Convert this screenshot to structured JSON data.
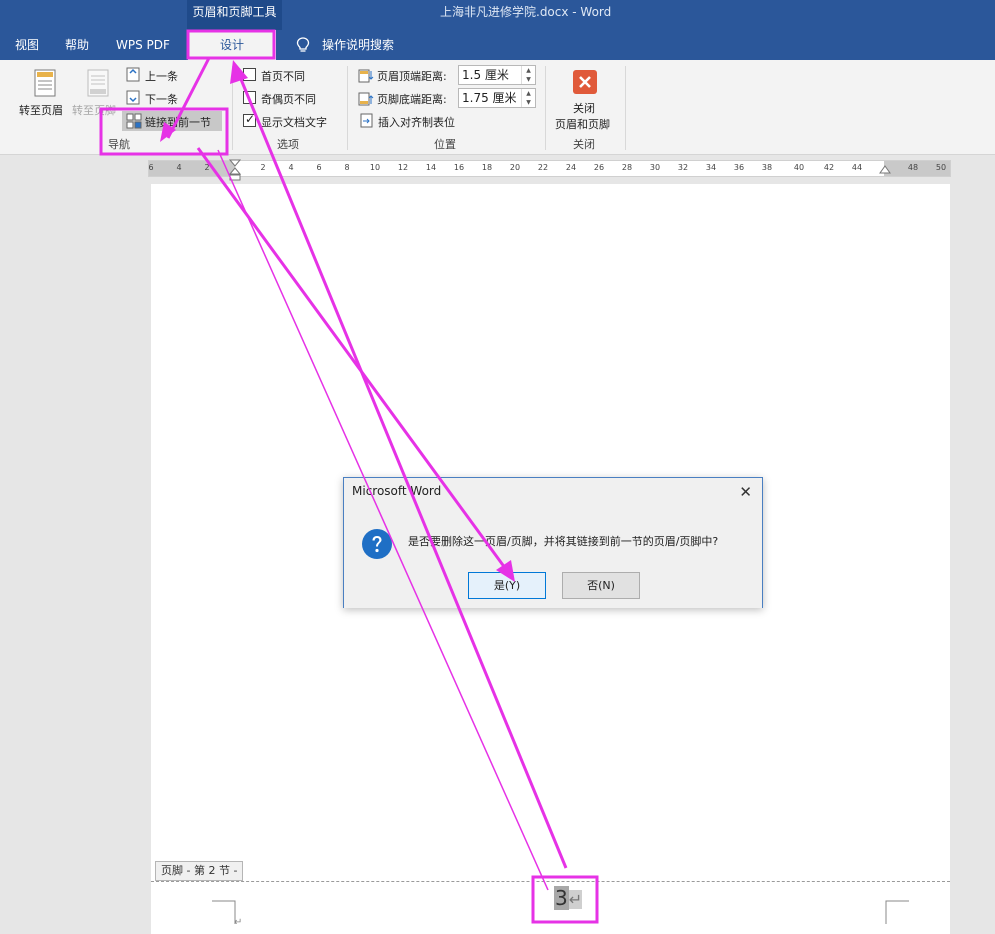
{
  "titlebar": {
    "context_tab_label": "页眉和页脚工具",
    "doc_title": "上海非凡进修学院.docx  -  Word"
  },
  "tabs": [
    {
      "label": "视图"
    },
    {
      "label": "帮助"
    },
    {
      "label": "WPS PDF"
    },
    {
      "label": "设计"
    }
  ],
  "tellme": {
    "label": "操作说明搜索",
    "icon": "lightbulb-icon"
  },
  "ribbon": {
    "navigation": {
      "goto_header": "转至页眉",
      "goto_footer": "转至页脚",
      "previous": "上一条",
      "next": "下一条",
      "link_to_previous": "链接到前一节",
      "group_label": "导航"
    },
    "options": {
      "different_first_page": "首页不同",
      "different_odd_even": "奇偶页不同",
      "show_document_text": "显示文档文字",
      "show_document_text_checked": true,
      "group_label": "选项"
    },
    "position": {
      "header_top_label": "页眉顶端距离:",
      "header_top_value": "1.5 厘米",
      "footer_bottom_label": "页脚底端距离:",
      "footer_bottom_value": "1.75 厘米",
      "insert_alignment_tab": "插入对齐制表位",
      "group_label": "位置"
    },
    "close": {
      "close_label_1": "关闭",
      "close_label_2": "页眉和页脚",
      "group_label": "关闭"
    }
  },
  "ruler": {
    "labels": [
      "6",
      "4",
      "2",
      "2",
      "4",
      "6",
      "8",
      "10",
      "12",
      "14",
      "16",
      "18",
      "20",
      "22",
      "24",
      "26",
      "28",
      "30",
      "32",
      "34",
      "36",
      "38",
      "40",
      "42",
      "44",
      "48",
      "50"
    ]
  },
  "document": {
    "footer_tag": "页脚 - 第 2 节 -",
    "page_number": "3",
    "return_mark": "↵"
  },
  "dialog": {
    "title": "Microsoft Word",
    "message": "是否要删除这一页眉/页脚，并将其链接到前一节的页眉/页脚中?",
    "yes_label": "是(Y)",
    "no_label": "否(N)",
    "icon": "question-icon"
  },
  "colors": {
    "word_blue": "#2b579a",
    "annotation": "#e632e6"
  }
}
